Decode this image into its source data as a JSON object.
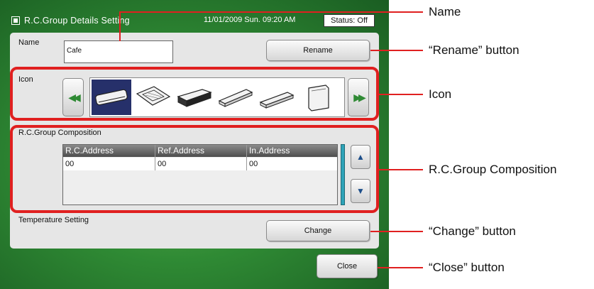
{
  "window": {
    "title": "R.C.Group Details Setting",
    "datetime": "11/01/2009 Sun. 09:20 AM",
    "status": "Status: Off"
  },
  "name_section": {
    "label": "Name",
    "value": "Cafe",
    "rename_label": "Rename"
  },
  "icon_section": {
    "label": "Icon",
    "prev_icon": "double-left-arrow-icon",
    "next_icon": "double-right-arrow-icon",
    "units": [
      {
        "icon": "wall-mounted-unit-icon",
        "selected": true
      },
      {
        "icon": "ceiling-cassette-unit-icon",
        "selected": false
      },
      {
        "icon": "ducted-unit-icon",
        "selected": false
      },
      {
        "icon": "ceiling-suspended-unit-icon",
        "selected": false
      },
      {
        "icon": "ceiling-suspended-unit-alt-icon",
        "selected": false
      },
      {
        "icon": "floor-standing-unit-icon",
        "selected": false
      }
    ]
  },
  "composition": {
    "label": "R.C.Group Composition",
    "columns": [
      "R.C.Address",
      "Ref.Address",
      "In.Address"
    ],
    "rows": [
      [
        "00",
        "00",
        "00"
      ]
    ],
    "scroll_up_icon": "triangle-up-icon",
    "scroll_down_icon": "triangle-down-icon"
  },
  "temperature": {
    "label": "Temperature Setting",
    "change_label": "Change"
  },
  "close_label": "Close",
  "callouts": {
    "name": "Name",
    "rename": "“Rename” button",
    "icon": "Icon",
    "composition": "R.C.Group Composition",
    "change": "“Change” button",
    "close": "“Close” button"
  },
  "colors": {
    "screen_green": "#2f8a34",
    "callout_red": "#e02020",
    "selected_navy": "#26306a",
    "scroll_teal": "#2ea3b8"
  }
}
